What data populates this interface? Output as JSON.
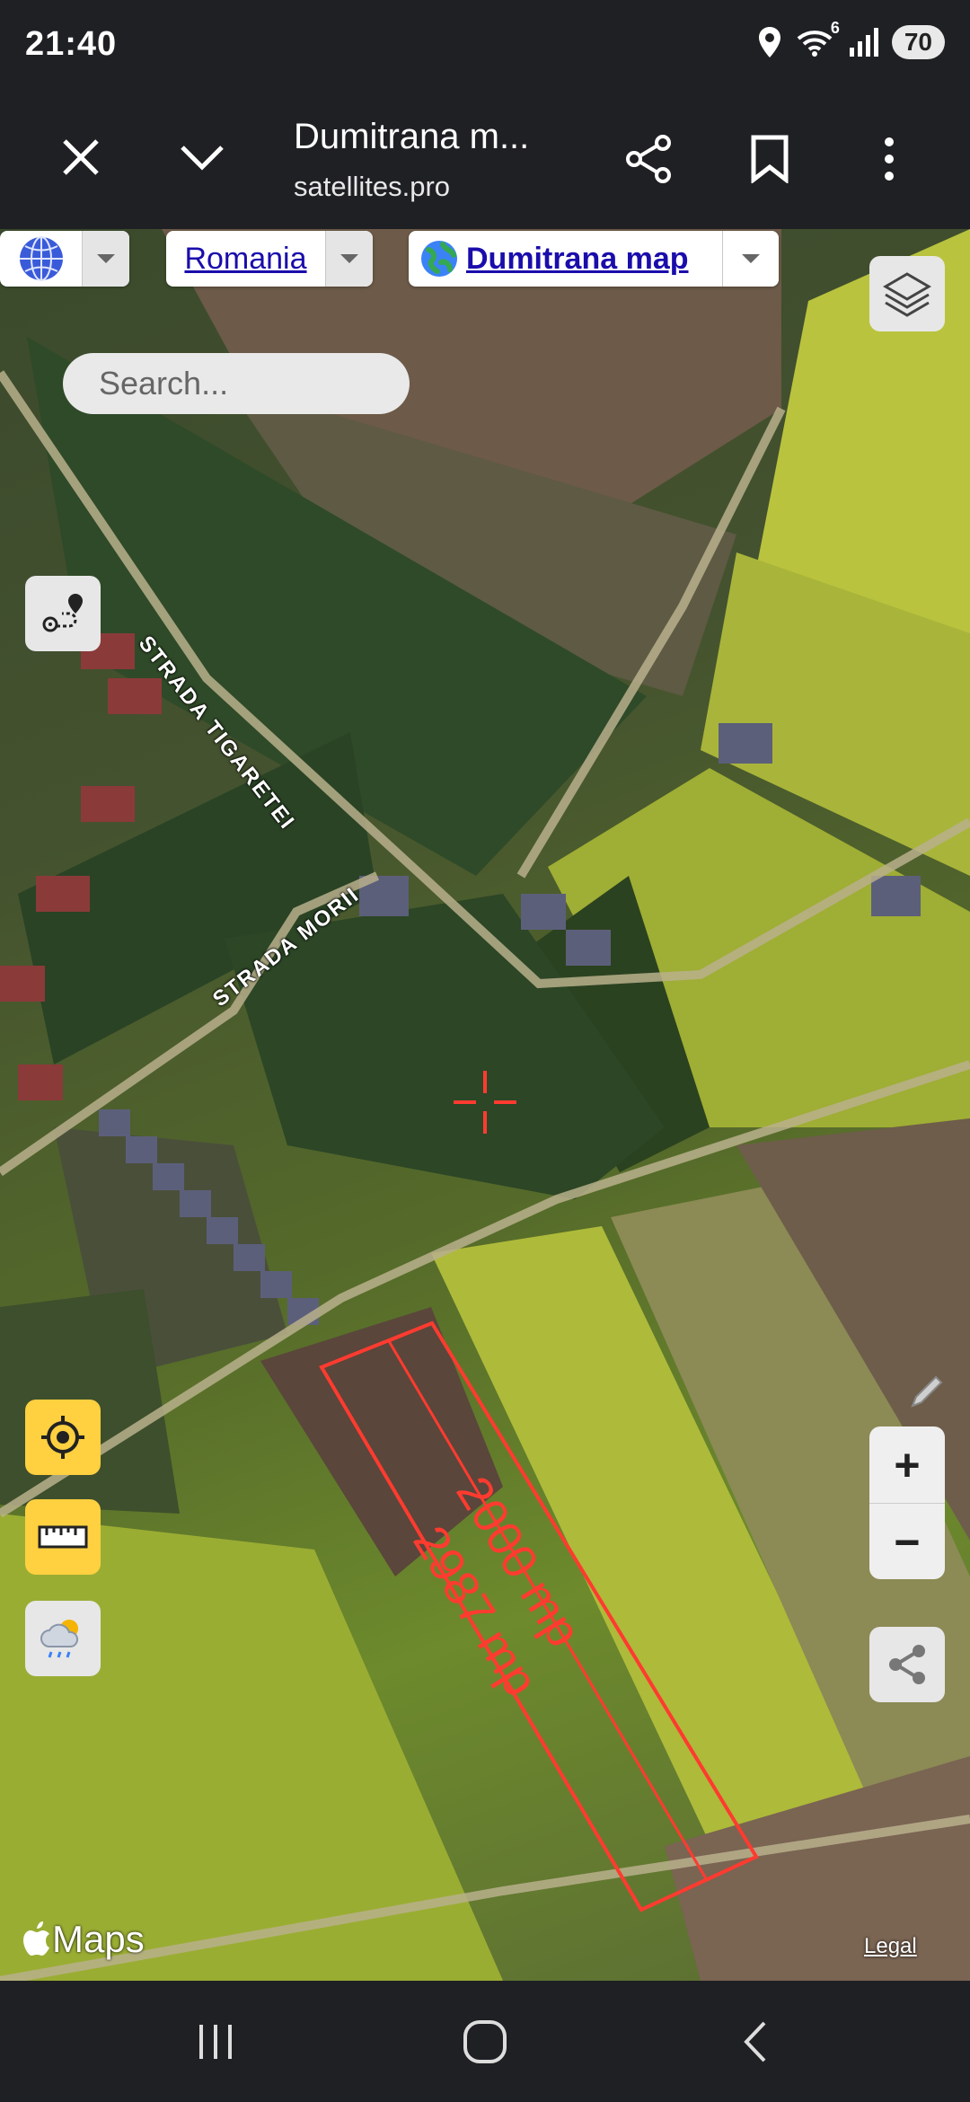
{
  "status_bar": {
    "time": "21:40",
    "wifi_badge": "6",
    "battery": "70"
  },
  "toolbar": {
    "title": "Dumitrana m...",
    "url": "satellites.pro"
  },
  "map": {
    "country_selector": "Romania",
    "map_selector": "Dumitrana map",
    "search_placeholder": "Search...",
    "road_labels": [
      "STRADA TIGARETEI",
      "STRADA MORII"
    ],
    "plot_labels": [
      "2000 mp",
      "2987 mp"
    ],
    "attribution": "Maps",
    "legal": "Legal",
    "zoom_in": "+",
    "zoom_out": "−"
  },
  "colors": {
    "plot_outline": "#ff3b30",
    "locate_button": "#ffd040",
    "chrome_bg": "#1f2024"
  }
}
